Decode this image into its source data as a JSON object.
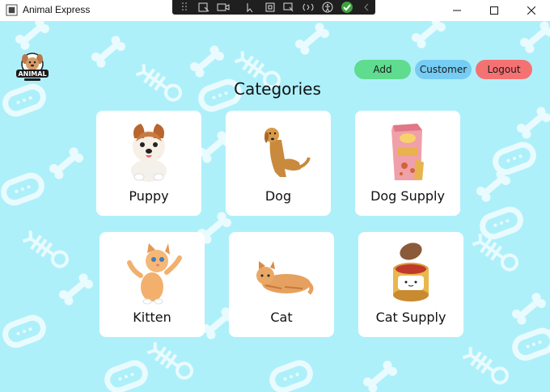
{
  "window": {
    "title": "Animal Express"
  },
  "header": {
    "logo_text": "ANIMAL",
    "buttons": {
      "add": "Add",
      "customer": "Customer",
      "logout": "Logout"
    },
    "heading": "Categories"
  },
  "categories": [
    {
      "label": "Puppy",
      "icon": "puppy-image"
    },
    {
      "label": "Dog",
      "icon": "dog-image"
    },
    {
      "label": "Dog Supply",
      "icon": "dog-food-bag-image"
    },
    {
      "label": "Kitten",
      "icon": "kitten-image"
    },
    {
      "label": "Cat",
      "icon": "cat-image"
    },
    {
      "label": "Cat Supply",
      "icon": "cat-food-can-image"
    }
  ],
  "colors": {
    "background": "#aef0fa",
    "add_button": "#5fdc8f",
    "customer_button": "#76ccf3",
    "logout_button": "#f57272"
  }
}
